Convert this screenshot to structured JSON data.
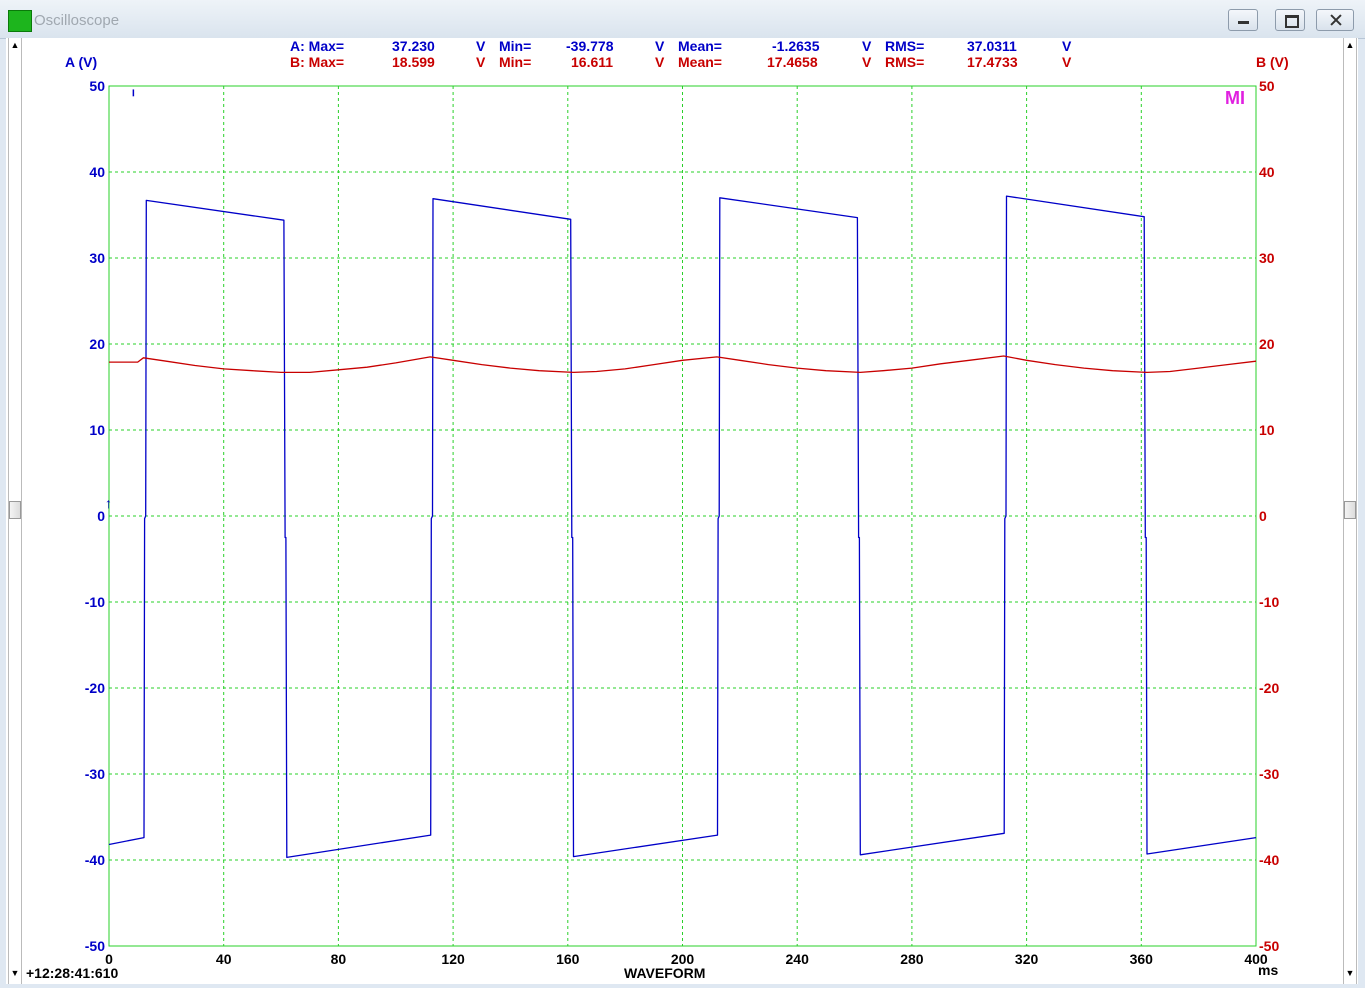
{
  "window": {
    "title": "Oscilloscope"
  },
  "stats": {
    "a": {
      "max_label": "A: Max=",
      "max": "37.230",
      "min_label": "Min=",
      "min": "-39.778",
      "mean_label": "Mean=",
      "mean": "-1.2635",
      "rms_label": "RMS=",
      "rms": "37.0311",
      "unit": "V"
    },
    "b": {
      "max_label": "B: Max=",
      "max": "18.599",
      "min_label": "Min=",
      "min": "16.611",
      "mean_label": "Mean=",
      "mean": "17.4658",
      "rms_label": "RMS=",
      "rms": "17.4733",
      "unit": "V"
    }
  },
  "footer": {
    "timestamp": "+12:28:41:610",
    "xlabel": "WAVEFORM"
  },
  "marker": "MI",
  "colors": {
    "a": "#0000c8",
    "b": "#c80000",
    "grid": "#2ad02a",
    "marker": "#e020e0"
  },
  "chart_data": {
    "type": "line",
    "xlabel": "ms",
    "ylabel_left": "A (V)",
    "ylabel_right": "B (V)",
    "xlim": [
      0,
      400
    ],
    "ylim": [
      -50,
      50
    ],
    "xticks": [
      "0",
      "40",
      "80",
      "120",
      "160",
      "200",
      "240",
      "280",
      "320",
      "360",
      "400"
    ],
    "yticks": [
      "50",
      "40",
      "30",
      "20",
      "10",
      "0",
      "-10",
      "-20",
      "-30",
      "-40",
      "-50"
    ],
    "series": [
      {
        "name": "A",
        "axis": "left",
        "x": [
          0,
          12.2,
          12.4,
          12.8,
          13.0,
          61.0,
          61.4,
          61.7,
          62.0,
          112.2,
          112.4,
          112.8,
          113.0,
          161.0,
          161.4,
          161.7,
          162.0,
          212.2,
          212.4,
          212.8,
          213.0,
          261.0,
          261.4,
          261.7,
          262.0,
          312.2,
          312.4,
          312.8,
          313.0,
          361.0,
          361.4,
          361.7,
          362.0,
          400
        ],
        "y": [
          -38.2,
          -37.4,
          -0.3,
          0.0,
          36.7,
          34.4,
          -2.5,
          -2.5,
          -39.7,
          -37.1,
          -0.3,
          0.0,
          36.9,
          34.5,
          -2.5,
          -2.5,
          -39.6,
          -37.1,
          -0.3,
          0.0,
          37.0,
          34.7,
          -2.5,
          -2.5,
          -39.4,
          -36.9,
          -0.3,
          0.0,
          37.2,
          34.8,
          -2.5,
          -2.5,
          -39.3,
          -37.4
        ]
      },
      {
        "name": "B",
        "axis": "right",
        "x": [
          0,
          10,
          12,
          20,
          30,
          40,
          50,
          60,
          70,
          80,
          90,
          100,
          112,
          120,
          130,
          140,
          150,
          162,
          170,
          180,
          190,
          200,
          212,
          220,
          230,
          240,
          250,
          262,
          270,
          280,
          290,
          300,
          312,
          320,
          330,
          340,
          350,
          362,
          370,
          380,
          390,
          400
        ],
        "y": [
          17.9,
          17.9,
          18.4,
          18.0,
          17.5,
          17.1,
          16.9,
          16.7,
          16.7,
          17.0,
          17.3,
          17.8,
          18.5,
          18.1,
          17.6,
          17.2,
          16.9,
          16.7,
          16.8,
          17.1,
          17.6,
          18.1,
          18.5,
          18.1,
          17.6,
          17.2,
          16.9,
          16.7,
          16.9,
          17.2,
          17.7,
          18.1,
          18.6,
          18.1,
          17.6,
          17.2,
          16.9,
          16.7,
          16.8,
          17.2,
          17.6,
          18.0
        ]
      }
    ]
  }
}
